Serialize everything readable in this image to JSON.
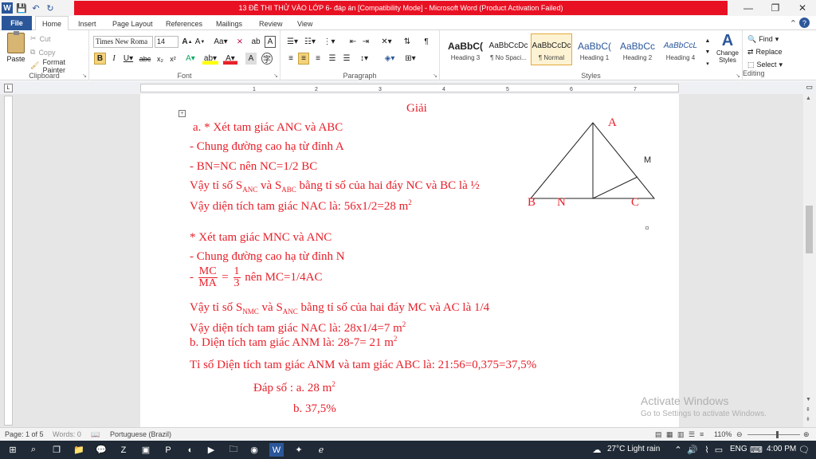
{
  "window": {
    "title": "13 ĐỀ THI THỬ VÀO LỚP 6- đáp án [Compatibility Mode]  -  Microsoft Word (Product Activation Failed)",
    "minimize": "—",
    "restore": "❐",
    "close": "✕"
  },
  "qat": {
    "word_logo": "W",
    "save": "💾",
    "undo": "↶",
    "redo": "↻"
  },
  "tabs": [
    "File",
    "Home",
    "Insert",
    "Page Layout",
    "References",
    "Mailings",
    "Review",
    "View"
  ],
  "ribbon": {
    "clipboard": {
      "paste": "Paste",
      "cut": "Cut",
      "copy": "Copy",
      "format_painter": "Format Painter",
      "label": "Clipboard"
    },
    "font": {
      "name": "Times New Roma",
      "size": "14",
      "label": "Font"
    },
    "paragraph": {
      "label": "Paragraph"
    },
    "styles": {
      "items": [
        {
          "sample": "AaBbC(",
          "name": "Heading 3"
        },
        {
          "sample": "AaBbCcDc",
          "name": "¶ No Spaci..."
        },
        {
          "sample": "AaBbCcDc",
          "name": "¶ Normal"
        },
        {
          "sample": "AaBbC(",
          "name": "Heading 1"
        },
        {
          "sample": "AaBbCc",
          "name": "Heading 2"
        },
        {
          "sample": "AaBbCcL",
          "name": "Heading 4"
        }
      ],
      "change_styles": "Change Styles",
      "label": "Styles"
    },
    "editing": {
      "find": "Find",
      "replace": "Replace",
      "select": "Select",
      "label": "Editing"
    }
  },
  "ruler": {
    "numbers": [
      "1",
      "2",
      "3",
      "4",
      "5",
      "6",
      "7"
    ]
  },
  "document": {
    "heading": "Giải",
    "lines": {
      "a_title": "a. * Xét tam giác ANC và ABC",
      "l2": "- Chung đường cao hạ từ đỉnh A",
      "l3": "- BN=NC nên NC=1/2 BC",
      "l4_a": "Vậy tỉ số S",
      "l4_sub1": "ANC",
      "l4_b": " và S",
      "l4_sub2": "ABC",
      "l4_c": " bằng tỉ số của hai đáy NC và BC là ½",
      "l5": "Vậy diện tích tam giác NAC là: 56x1/2=28 m",
      "l5_sup": "2",
      "l6": "* Xét tam giác MNC và ANC",
      "l7": "- Chung đường cao hạ từ đỉnh N",
      "l8_dash": "-",
      "l8_num1": "MC",
      "l8_den1": "MA",
      "l8_eq": "=",
      "l8_num2": "1",
      "l8_den2": "3",
      "l8_rest": " nên MC=1/4AC",
      "l9_a": "Vậy tỉ số S",
      "l9_sub1": "NMC",
      "l9_b": " và S",
      "l9_sub2": "ANC",
      "l9_c": " bằng tỉ số của hai đáy MC và AC là 1/4",
      "l10": "Vậy diện tích tam giác NAC là: 28x1/4=7 m",
      "l10_sup": "2",
      "l11": "b. Diện tích tam giác ANM là: 28-7= 21 m",
      "l11_sup": "2",
      "l12": "Tỉ số Diện tích tam giác ANM và tam giác ABC là: 21:56=0,375=37,5%",
      "l13": "Đáp số : a. 28 m",
      "l13_sup": "2",
      "l14": "b. 37,5%"
    },
    "figure": {
      "A": "A",
      "B": "B",
      "N": "N",
      "C": "C",
      "M": "M"
    }
  },
  "watermark": {
    "line1": "Activate Windows",
    "line2": "Go to Settings to activate Windows."
  },
  "status": {
    "page": "Page: 1 of 5",
    "words": "Words: 0",
    "language": "Portuguese (Brazil)",
    "zoom": "110%"
  },
  "taskbar": {
    "weather": "27°C  Light rain",
    "lang": "ENG",
    "time": "4:00 PM"
  },
  "colors": {
    "accent": "#2b579a",
    "doc_text": "#e8202a",
    "title_red": "#e81123"
  }
}
